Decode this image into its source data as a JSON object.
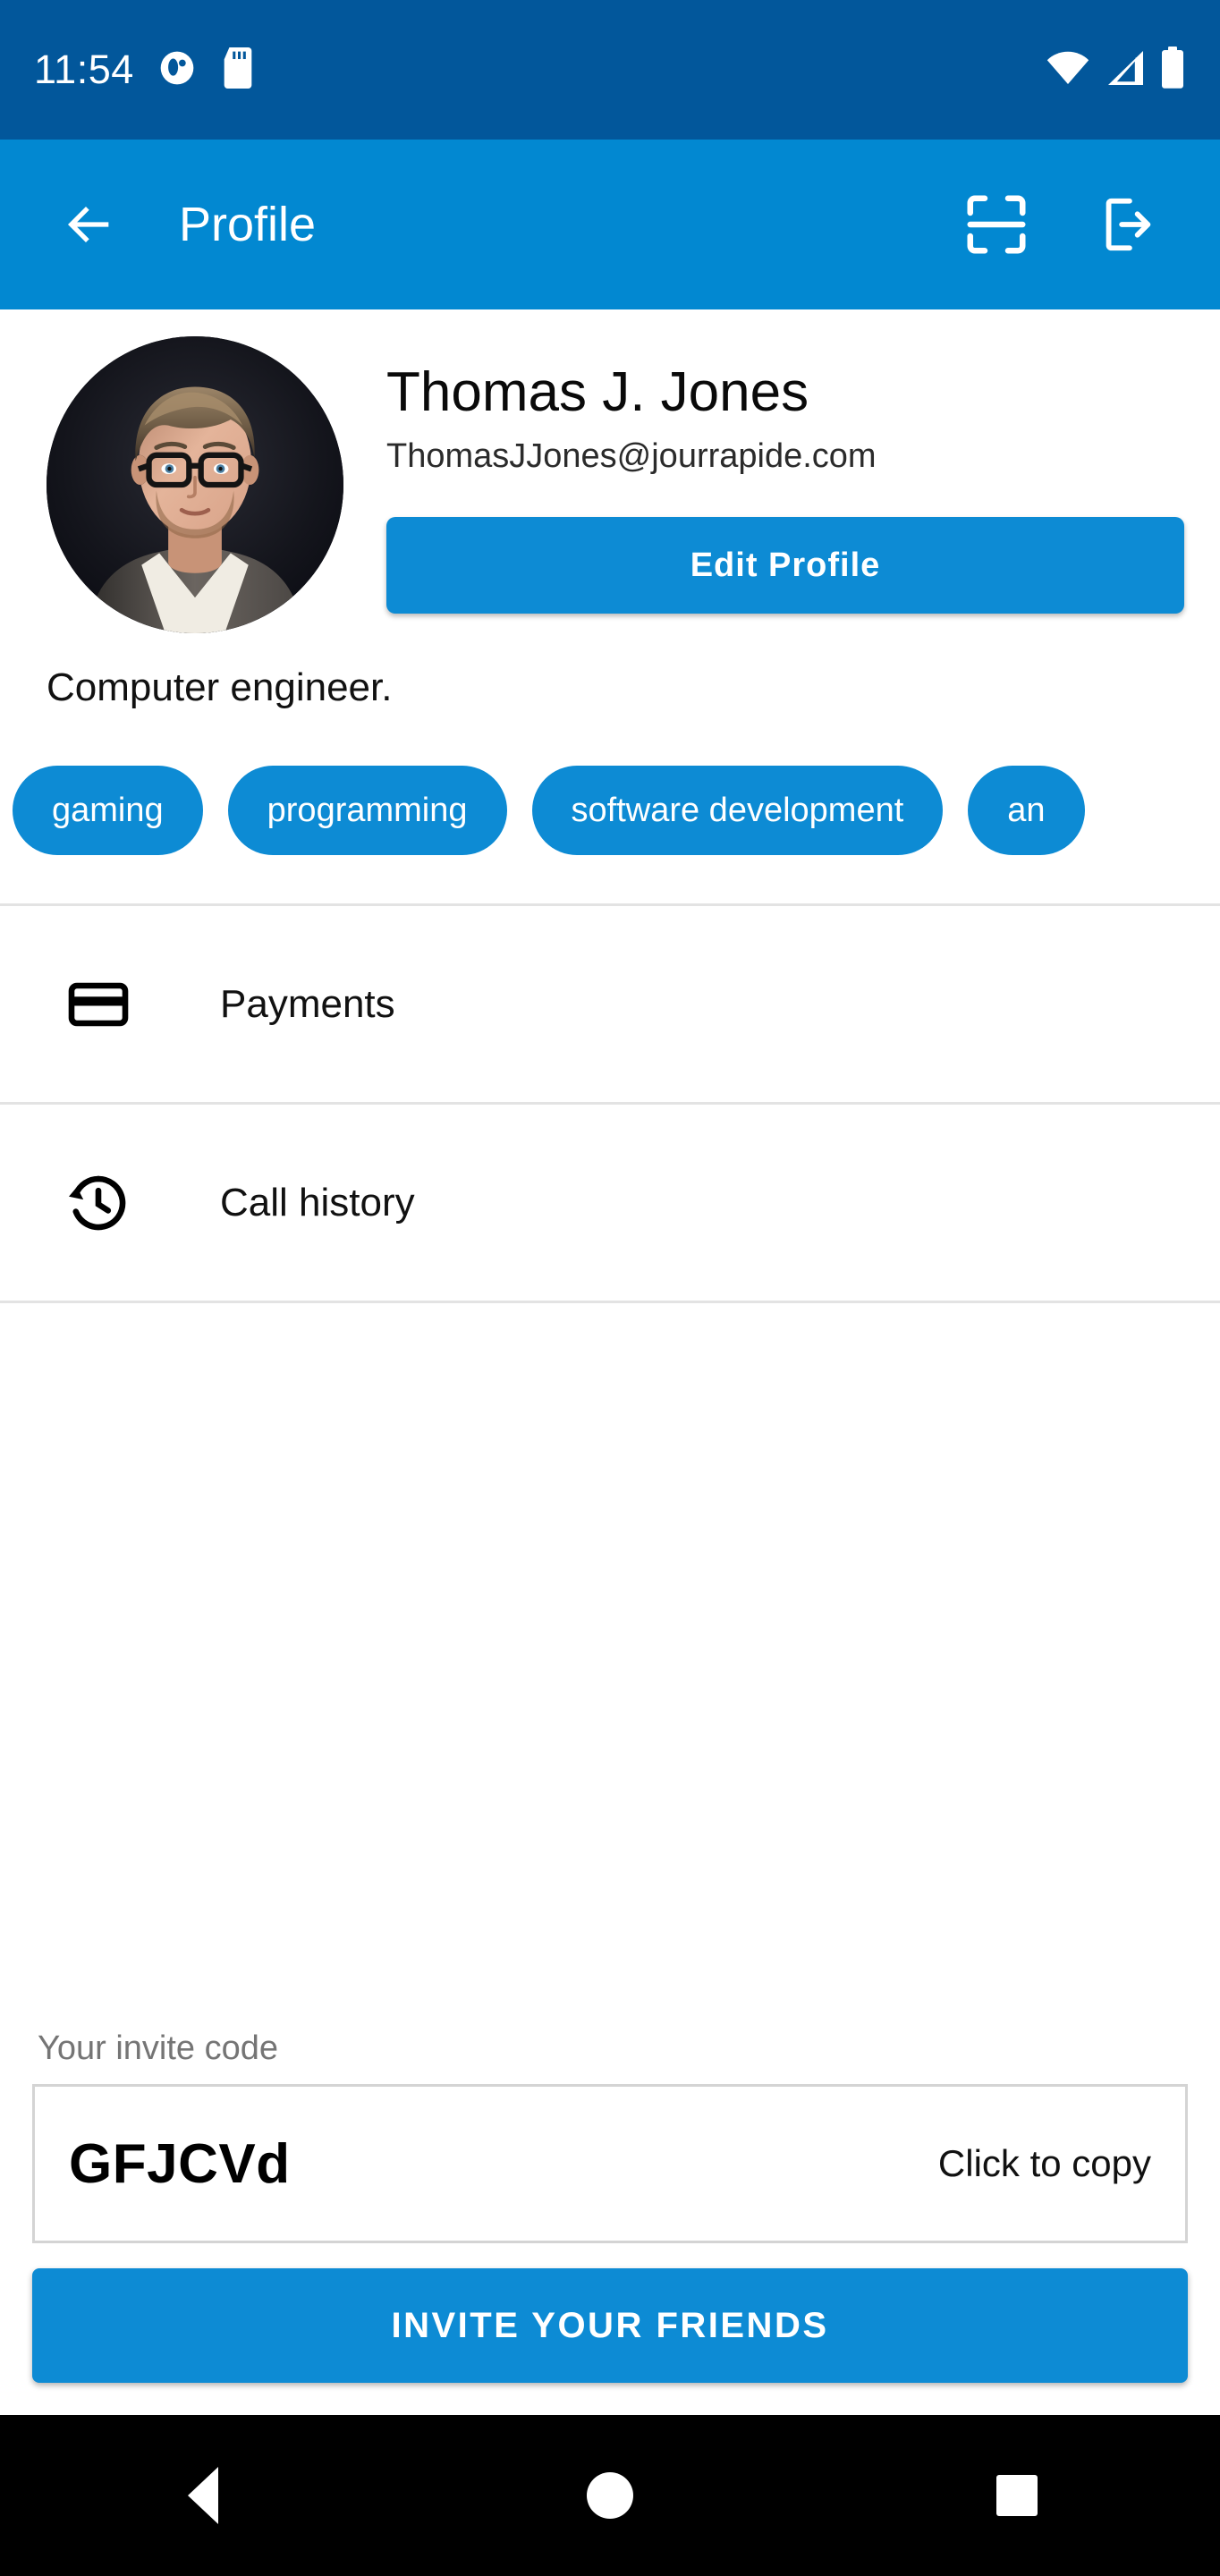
{
  "status_bar": {
    "time": "11:54",
    "left_icons": [
      "notification-dot-icon",
      "sd-card-icon"
    ],
    "right_icons": [
      "wifi-icon",
      "cellular-signal-icon",
      "battery-icon"
    ],
    "background_color": "#02579b"
  },
  "app_bar": {
    "title": "Profile",
    "back_icon": "arrow-left-icon",
    "actions": [
      {
        "icon": "qr-scan-icon",
        "name": "scan-qr-button"
      },
      {
        "icon": "logout-icon",
        "name": "logout-button"
      }
    ],
    "background_color": "#0288d1"
  },
  "profile": {
    "name": "Thomas J. Jones",
    "email": "ThomasJJones@jourrapide.com",
    "edit_button_label": "Edit Profile",
    "bio": "Computer engineer.",
    "avatar_alt": "profile-photo"
  },
  "tags": [
    "gaming",
    "programming",
    "software development",
    "an"
  ],
  "menu": [
    {
      "label": "Payments",
      "icon": "credit-card-icon",
      "name": "menu-item-payments"
    },
    {
      "label": "Call history",
      "icon": "history-clock-icon",
      "name": "menu-item-call-history"
    }
  ],
  "invite": {
    "label": "Your invite code",
    "code": "GFJCVd",
    "copy_hint": "Click to copy",
    "button_label": "INVITE YOUR FRIENDS"
  },
  "nav_bar": {
    "back": "back-triangle-icon",
    "home": "home-circle-icon",
    "recents": "recents-square-icon"
  },
  "colors": {
    "accent": "#0d8bd4",
    "app_bar": "#0288d1",
    "status_bar": "#02579b",
    "divider": "#e3e3e3",
    "muted_text": "#757575"
  }
}
